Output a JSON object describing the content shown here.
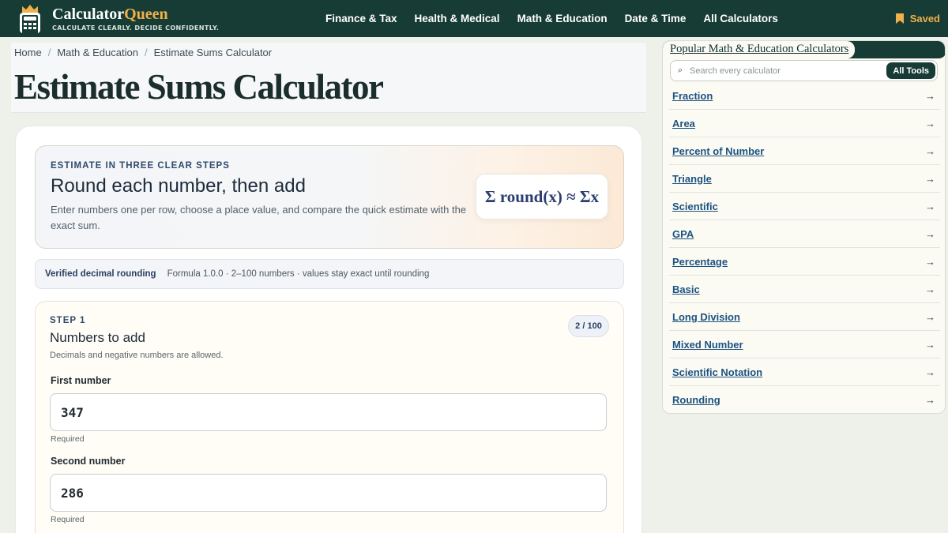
{
  "header": {
    "brand_main": "Calculator",
    "brand_accent": "Queen",
    "tagline": "CALCULATE CLEARLY. DECIDE CONFIDENTLY.",
    "nav": [
      "Finance & Tax",
      "Health & Medical",
      "Math & Education",
      "Date & Time",
      "All Calculators"
    ],
    "saved_label": "Saved"
  },
  "breadcrumb": [
    "Home",
    "Math & Education",
    "Estimate Sums Calculator"
  ],
  "page_title": "Estimate Sums Calculator",
  "hero": {
    "kicker": "ESTIMATE IN THREE CLEAR STEPS",
    "title": "Round each number, then add",
    "description": "Enter numbers one per row, choose a place value, and compare the quick estimate with the exact sum.",
    "formula": "Σ round(x) ≈ Σx"
  },
  "meta": {
    "verified": "Verified decimal rounding",
    "info": "Formula 1.0.0 · 2–100 numbers · values stay exact until rounding"
  },
  "step1": {
    "label": "STEP 1",
    "title": "Numbers to add",
    "hint": "Decimals and negative numbers are allowed.",
    "count": "2 / 100",
    "fields": [
      {
        "label": "First number",
        "value": "347",
        "note": "Required"
      },
      {
        "label": "Second number",
        "value": "286",
        "note": "Required"
      }
    ]
  },
  "sidebar": {
    "heading": "Popular Math & Education Calculators",
    "search_placeholder": "Search every calculator",
    "all_tools": "All Tools",
    "items": [
      "Fraction",
      "Area",
      "Percent of Number",
      "Triangle",
      "Scientific",
      "GPA",
      "Percentage",
      "Basic",
      "Long Division",
      "Mixed Number",
      "Scientific Notation",
      "Rounding"
    ],
    "arrow": "→"
  },
  "colors": {
    "header_bg": "#173c35",
    "accent": "#f0b04a",
    "link": "#1d5280"
  }
}
